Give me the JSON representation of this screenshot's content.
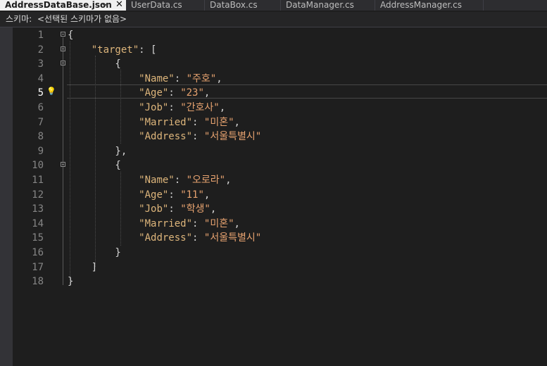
{
  "tabs": [
    {
      "label": "AddressDataBase.json",
      "active": true,
      "pin_icon": "pin-icon",
      "close_icon": "close-icon"
    },
    {
      "label": "UserData.cs",
      "active": false
    },
    {
      "label": "DataBox.cs",
      "active": false
    },
    {
      "label": "DataManager.cs",
      "active": false
    },
    {
      "label": "AddressManager.cs",
      "active": false
    }
  ],
  "schema": {
    "label": "스키마:",
    "value": "<선택된 스키마가 없음>"
  },
  "editor": {
    "current_line": 5,
    "lines": [
      {
        "num": "1",
        "text": "{"
      },
      {
        "num": "2",
        "text": "    \"target\": ["
      },
      {
        "num": "3",
        "text": "        {"
      },
      {
        "num": "4",
        "text": "            \"Name\": \"주호\","
      },
      {
        "num": "5",
        "text": "            \"Age\": \"23\","
      },
      {
        "num": "6",
        "text": "            \"Job\": \"간호사\","
      },
      {
        "num": "7",
        "text": "            \"Married\": \"미혼\","
      },
      {
        "num": "8",
        "text": "            \"Address\": \"서울특별시\""
      },
      {
        "num": "9",
        "text": "        },"
      },
      {
        "num": "10",
        "text": "        {"
      },
      {
        "num": "11",
        "text": "            \"Name\": \"오로라\","
      },
      {
        "num": "12",
        "text": "            \"Age\": \"11\","
      },
      {
        "num": "13",
        "text": "            \"Job\": \"학생\","
      },
      {
        "num": "14",
        "text": "            \"Married\": \"미혼\","
      },
      {
        "num": "15",
        "text": "            \"Address\": \"서울특별시\""
      },
      {
        "num": "16",
        "text": "        }"
      },
      {
        "num": "17",
        "text": "    ]"
      },
      {
        "num": "18",
        "text": "}"
      }
    ]
  },
  "colors": {
    "key": "#ddb57b",
    "string": "#e6a26f",
    "punctuation": "#d4d4d4",
    "line_number": "#858585"
  }
}
